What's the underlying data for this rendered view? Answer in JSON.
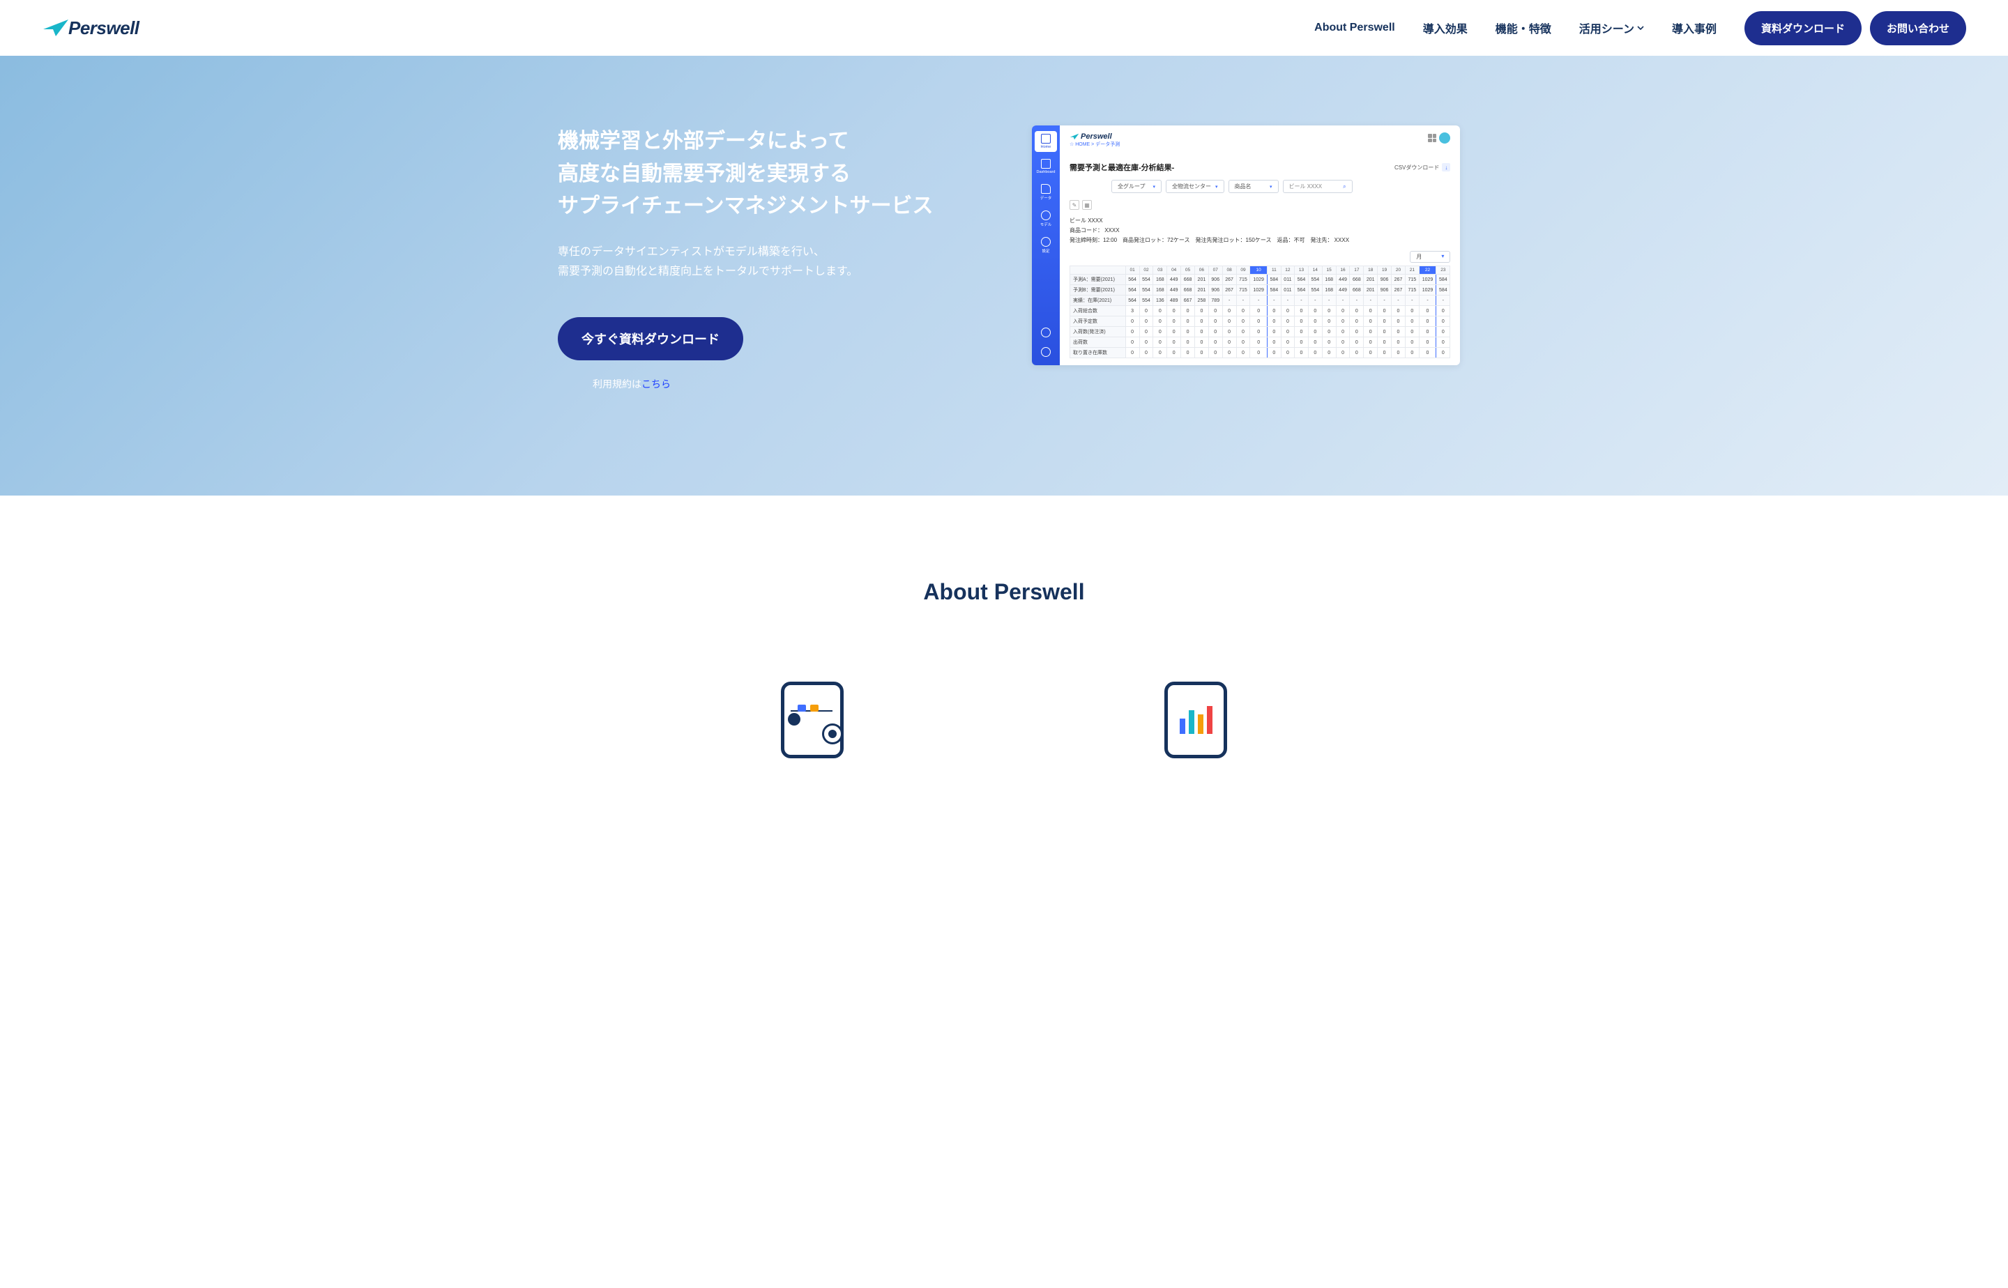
{
  "brand": "Perswell",
  "nav": {
    "items": [
      {
        "label": "About Perswell"
      },
      {
        "label": "導入効果"
      },
      {
        "label": "機能・特徴"
      },
      {
        "label": "活用シーン",
        "dropdown": true
      },
      {
        "label": "導入事例"
      }
    ],
    "download": "資料ダウンロード",
    "contact": "お問い合わせ"
  },
  "hero": {
    "title_l1": "機械学習と外部データによって",
    "title_l2": "高度な自動需要予測を実現する",
    "title_l3": "サプライチェーンマネジメントサービス",
    "desc_l1": "専任のデータサイエンティストがモデル構築を行い、",
    "desc_l2": "需要予測の自動化と精度向上をトータルでサポートします。",
    "cta": "今すぐ資料ダウンロード",
    "terms_prefix": "利用規約は",
    "terms_link": "こちら"
  },
  "mock": {
    "sidebar": {
      "home": "Home",
      "dashboard": "Dashboard",
      "data": "データ",
      "model": "モデル",
      "settings": "設定"
    },
    "breadcrumb": "☆ HOME > データ予測",
    "panel_title": "需要予測と最適在庫-分析結果-",
    "csv": "CSVダウンロード",
    "filters": {
      "group": "全グループ",
      "center": "全物流センター",
      "name": "商品名",
      "search": "ビール XXXX"
    },
    "meta": {
      "product": "ビール XXXX",
      "code": "商品コード： XXXX",
      "detail": "発注締時刻：12:00　商品発注ロット：72ケース　発注先発注ロット：150ケース　返品：不可　発注先： XXXX"
    },
    "month_sel": "月",
    "columns": [
      "01",
      "02",
      "03",
      "04",
      "05",
      "06",
      "07",
      "08",
      "09",
      "10",
      "11",
      "12",
      "13",
      "14",
      "15",
      "16",
      "17",
      "18",
      "19",
      "20",
      "21",
      "22",
      "23"
    ],
    "rows": [
      {
        "label": "予測A：需要(2021)",
        "cells": [
          "564",
          "554",
          "168",
          "449",
          "668",
          "201",
          "906",
          "267",
          "715",
          "1029",
          "584",
          "011",
          "564",
          "554",
          "168",
          "449",
          "668",
          "201",
          "906",
          "267",
          "715",
          "1029",
          "584"
        ]
      },
      {
        "label": "予測B：需要(2021)",
        "cells": [
          "564",
          "554",
          "168",
          "449",
          "668",
          "201",
          "906",
          "267",
          "715",
          "1029",
          "584",
          "011",
          "564",
          "554",
          "168",
          "449",
          "668",
          "201",
          "906",
          "267",
          "715",
          "1029",
          "584"
        ]
      },
      {
        "label": "実績：在庫(2021)",
        "cells": [
          "564",
          "554",
          "136",
          "489",
          "667",
          "258",
          "789",
          "-",
          "-",
          "-",
          "-",
          "-",
          "-",
          "-",
          "-",
          "-",
          "-",
          "-",
          "-",
          "-",
          "-",
          "-",
          "-"
        ]
      },
      {
        "label": "入荷総合数",
        "cells": [
          "3",
          "0",
          "0",
          "0",
          "0",
          "0",
          "0",
          "0",
          "0",
          "0",
          "0",
          "0",
          "0",
          "0",
          "0",
          "0",
          "0",
          "0",
          "0",
          "0",
          "0",
          "0",
          "0"
        ]
      },
      {
        "label": "入荷予定数",
        "cells": [
          "0",
          "0",
          "0",
          "0",
          "0",
          "0",
          "0",
          "0",
          "0",
          "0",
          "0",
          "0",
          "0",
          "0",
          "0",
          "0",
          "0",
          "0",
          "0",
          "0",
          "0",
          "0",
          "0"
        ]
      },
      {
        "label": "入荷数(発注済)",
        "cells": [
          "0",
          "0",
          "0",
          "0",
          "0",
          "0",
          "0",
          "0",
          "0",
          "0",
          "0",
          "0",
          "0",
          "0",
          "0",
          "0",
          "0",
          "0",
          "0",
          "0",
          "0",
          "0",
          "0"
        ]
      },
      {
        "label": "出荷数",
        "cells": [
          "0",
          "0",
          "0",
          "0",
          "0",
          "0",
          "0",
          "0",
          "0",
          "0",
          "0",
          "0",
          "0",
          "0",
          "0",
          "0",
          "0",
          "0",
          "0",
          "0",
          "0",
          "0",
          "0"
        ]
      },
      {
        "label": "取り置き在庫数",
        "cells": [
          "0",
          "0",
          "0",
          "0",
          "0",
          "0",
          "0",
          "0",
          "0",
          "0",
          "0",
          "0",
          "0",
          "0",
          "0",
          "0",
          "0",
          "0",
          "0",
          "0",
          "0",
          "0",
          "0"
        ]
      }
    ],
    "highlight_cols": [
      9,
      21
    ]
  },
  "about": {
    "title": "About Perswell"
  }
}
